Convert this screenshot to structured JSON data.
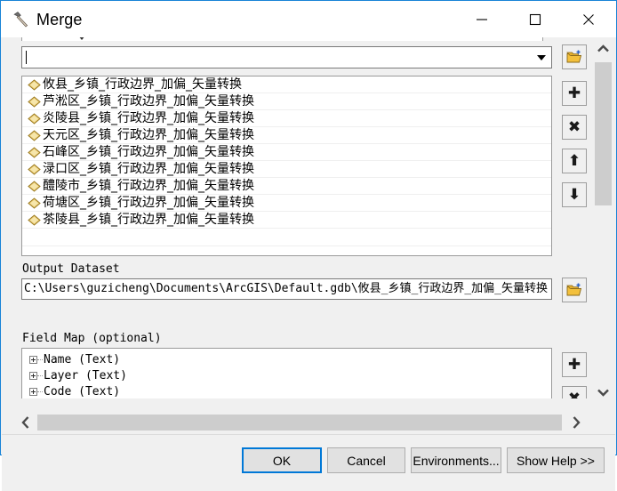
{
  "window": {
    "title": "Merge",
    "icon": "hammer-tool-icon",
    "accent_color": "#1883d7",
    "caption_buttons": [
      {
        "name": "minimize",
        "glyph": "minimize-icon"
      },
      {
        "name": "maximize",
        "glyph": "maximize-icon"
      },
      {
        "name": "close",
        "glyph": "close-icon"
      }
    ]
  },
  "input_combo": {
    "value": "",
    "placeholder": "",
    "caret_icon": "chevron-down-icon"
  },
  "input_list": {
    "items": [
      "攸县_乡镇_行政边界_加偏_矢量转换",
      "芦淞区_乡镇_行政边界_加偏_矢量转换",
      "炎陵县_乡镇_行政边界_加偏_矢量转换",
      "天元区_乡镇_行政边界_加偏_矢量转换",
      "石峰区_乡镇_行政边界_加偏_矢量转换",
      "渌口区_乡镇_行政边界_加偏_矢量转换",
      "醴陵市_乡镇_行政边界_加偏_矢量转换",
      "荷塘区_乡镇_行政边界_加偏_矢量转换",
      "茶陵县_乡镇_行政边界_加偏_矢量转换"
    ],
    "item_icon": "polygon-feature-icon",
    "item_icon_color": "#e8c76a"
  },
  "output_dataset": {
    "label": "Output Dataset",
    "value": "C:\\Users\\guzicheng\\Documents\\ArcGIS\\Default.gdb\\攸县_乡镇_行政边界_加偏_矢量转换"
  },
  "field_map": {
    "label": "Field Map (optional)",
    "rows": [
      "Name (Text)",
      "Layer (Text)",
      "Code (Text)"
    ]
  },
  "toolbar": {
    "browse_input_icon": "open-folder-icon",
    "add_icon": "plus-icon",
    "remove_icon": "cross-icon",
    "move_up_icon": "arrow-up-icon",
    "move_down_icon": "arrow-down-icon",
    "browse_output_icon": "open-folder-icon",
    "fieldmap_add_icon": "plus-icon",
    "fieldmap_remove_icon": "cross-icon"
  },
  "scrollbars": {
    "vertical": {
      "up_icon": "chevron-up-icon",
      "down_icon": "chevron-down-icon"
    },
    "horizontal": {
      "left_icon": "chevron-left-icon",
      "right_icon": "chevron-right-icon"
    }
  },
  "buttons": {
    "ok": "OK",
    "cancel": "Cancel",
    "environments": "Environments...",
    "show_help": "Show Help >>"
  }
}
